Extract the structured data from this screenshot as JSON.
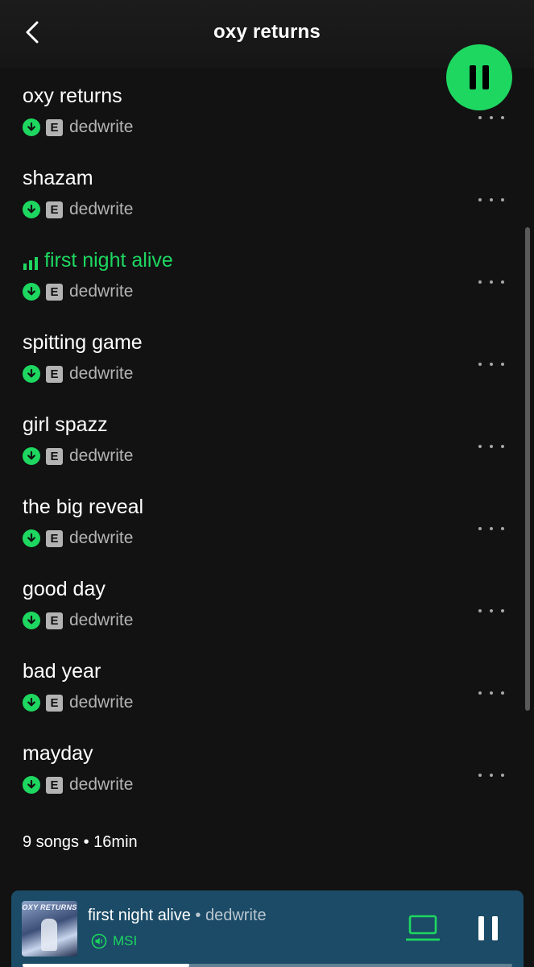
{
  "header": {
    "title": "oxy returns",
    "back_icon": "chevron-left-icon"
  },
  "play_button": {
    "icon": "pause-icon",
    "color": "#1ed760"
  },
  "tracks": [
    {
      "title": "oxy returns",
      "explicit": "E",
      "artist": "dedwrite",
      "downloaded": true
    },
    {
      "title": "shazam",
      "explicit": "E",
      "artist": "dedwrite",
      "downloaded": true
    },
    {
      "title": "first night alive",
      "explicit": "E",
      "artist": "dedwrite",
      "downloaded": true,
      "now_playing": true
    },
    {
      "title": "spitting game",
      "explicit": "E",
      "artist": "dedwrite",
      "downloaded": true
    },
    {
      "title": "girl spazz",
      "explicit": "E",
      "artist": "dedwrite",
      "downloaded": true
    },
    {
      "title": "the big reveal",
      "explicit": "E",
      "artist": "dedwrite",
      "downloaded": true
    },
    {
      "title": "good day",
      "explicit": "E",
      "artist": "dedwrite",
      "downloaded": true
    },
    {
      "title": "bad year",
      "explicit": "E",
      "artist": "dedwrite",
      "downloaded": true
    },
    {
      "title": "mayday",
      "explicit": "E",
      "artist": "dedwrite",
      "downloaded": true
    }
  ],
  "summary": "9 songs • 16min",
  "mini_player": {
    "cover_text": "OXY RETURNS",
    "title": "first night alive",
    "separator": " • ",
    "artist": "dedwrite",
    "device": "MSI",
    "device_icon": "speaker-icon",
    "connect_icon": "laptop-icon",
    "control_icon": "pause-icon",
    "progress": 0.34,
    "background": "#1b4b66"
  },
  "colors": {
    "accent": "#1ed760",
    "background": "#121212",
    "secondary_text": "#b3b3b3"
  }
}
